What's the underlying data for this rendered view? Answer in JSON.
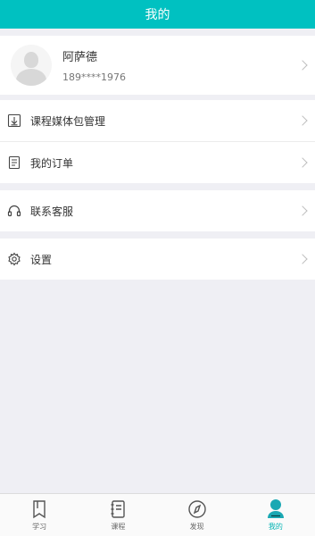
{
  "header": {
    "title": "我的"
  },
  "profile": {
    "name": "阿萨德",
    "phone": "189****1976"
  },
  "menu": {
    "media": "课程媒体包管理",
    "orders": "我的订单",
    "service": "联系客服",
    "settings": "设置"
  },
  "nav": {
    "items": [
      {
        "label": "学习",
        "icon": "study-icon"
      },
      {
        "label": "课程",
        "icon": "course-icon"
      },
      {
        "label": "发现",
        "icon": "discover-icon"
      },
      {
        "label": "我的",
        "icon": "profile-icon"
      }
    ],
    "active_index": 3
  },
  "colors": {
    "accent": "#00c1c1",
    "background": "#efeff4"
  }
}
